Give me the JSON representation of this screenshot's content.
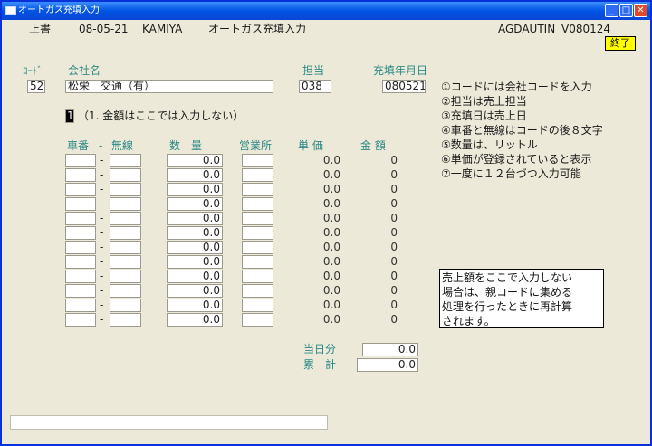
{
  "window": {
    "title": "オートガス充填入力"
  },
  "header": {
    "mode": "上書",
    "date": "08-05-21",
    "user": "KAMIYA",
    "screen_title": "オートガス充填入力",
    "program_id": "AGDAUTIN",
    "version": "V080124",
    "end_button": "終了"
  },
  "labels": {
    "code": "ｺｰﾄﾞ",
    "company": "会社名",
    "staff": "担当",
    "fill_date": "充填年月日"
  },
  "form": {
    "code": "52",
    "company_name": "松栄　交通（有）",
    "staff": "038",
    "fill_date": "080521",
    "mode_value": "1",
    "mode_note": "（1. 金額はここでは入力しない）"
  },
  "instructions": [
    "①コードには会社コードを入力",
    "②担当は売上担当",
    "③充填日は売上日",
    "④車番と無線はコードの後８文字",
    "⑤数量は、リットル",
    "⑥単価が登録されていると表示",
    "⑦一度に１２台づつ入力可能"
  ],
  "table": {
    "headers": {
      "car_no": "車番",
      "dash": "-",
      "radio": "無線",
      "quantity": "数　量",
      "office": "営業所",
      "unit_price": "単 価",
      "amount": "金 額"
    },
    "rows": [
      {
        "quantity": "0.0",
        "unit_price": "0.0",
        "amount": "0"
      },
      {
        "quantity": "0.0",
        "unit_price": "0.0",
        "amount": "0"
      },
      {
        "quantity": "0.0",
        "unit_price": "0.0",
        "amount": "0"
      },
      {
        "quantity": "0.0",
        "unit_price": "0.0",
        "amount": "0"
      },
      {
        "quantity": "0.0",
        "unit_price": "0.0",
        "amount": "0"
      },
      {
        "quantity": "0.0",
        "unit_price": "0.0",
        "amount": "0"
      },
      {
        "quantity": "0.0",
        "unit_price": "0.0",
        "amount": "0"
      },
      {
        "quantity": "0.0",
        "unit_price": "0.0",
        "amount": "0"
      },
      {
        "quantity": "0.0",
        "unit_price": "0.0",
        "amount": "0"
      },
      {
        "quantity": "0.0",
        "unit_price": "0.0",
        "amount": "0"
      },
      {
        "quantity": "0.0",
        "unit_price": "0.0",
        "amount": "0"
      },
      {
        "quantity": "0.0",
        "unit_price": "0.0",
        "amount": "0"
      }
    ]
  },
  "note": [
    "売上額をここで入力しない",
    "場合は、親コードに集める",
    "処理を行ったときに再計算",
    "されます。"
  ],
  "totals": {
    "today_label": "当日分",
    "today_value": "0.0",
    "cumulative_label": "累　計",
    "cumulative_value": "0.0"
  },
  "colors": {
    "title_bar": "#0054e3",
    "window_bg": "#ece9d8",
    "label_teal": "#2b8a86",
    "end_button": "#ffff00"
  }
}
